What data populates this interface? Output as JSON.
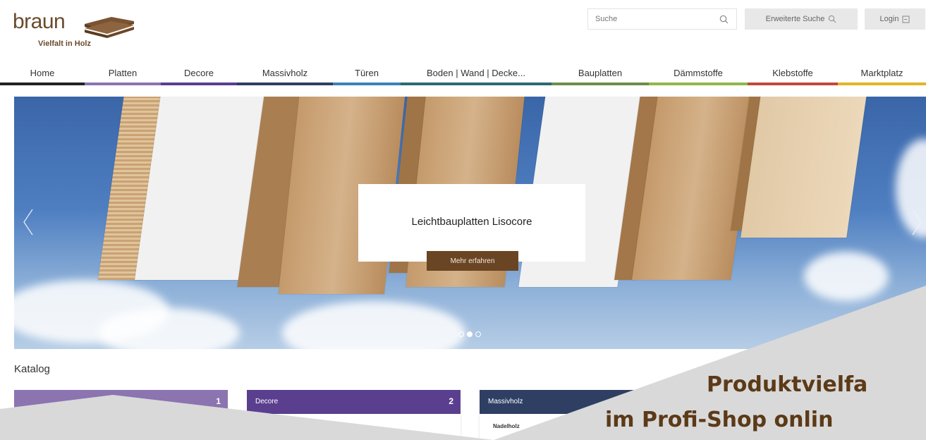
{
  "header": {
    "logo_word": "braun",
    "logo_tagline": "Vielfalt in Holz",
    "search_placeholder": "Suche",
    "advanced_search_label": "Erweiterte Suche",
    "login_label": "Login"
  },
  "nav": {
    "items": [
      {
        "label": "Home",
        "color": "#222222"
      },
      {
        "label": "Platten",
        "color": "#8b74b0"
      },
      {
        "label": "Decore",
        "color": "#5b3f8f"
      },
      {
        "label": "Massivholz",
        "color": "#2e3f63"
      },
      {
        "label": "Türen",
        "color": "#3b82bf"
      },
      {
        "label": "Boden | Wand | Decke...",
        "color": "#2c6b6f"
      },
      {
        "label": "Bauplatten",
        "color": "#6d8f4e"
      },
      {
        "label": "Dämmstoffe",
        "color": "#8fb84a"
      },
      {
        "label": "Klebstoffe",
        "color": "#c0493a"
      },
      {
        "label": "Marktplatz",
        "color": "#e3b428"
      }
    ]
  },
  "hero": {
    "title": "Leichtbauplatten Lisocore",
    "cta": "Mehr erfahren",
    "slides": 3,
    "active_slide": 2
  },
  "catalog": {
    "heading": "Katalog",
    "tiles": [
      {
        "title": "",
        "number": "1",
        "color": "#8b74b0"
      },
      {
        "title": "Decore",
        "number": "2",
        "color": "#5b3f8f"
      },
      {
        "title": "Massivholz",
        "number": "",
        "color": "#2e3f63"
      }
    ],
    "massivholz_item": "Nadelholz"
  },
  "promo": {
    "line1": "Produktvielfa",
    "line2": "im Profi-Shop onlin"
  },
  "colors": {
    "brand_brown": "#6a4524",
    "overlay_grey": "#d9d9d9"
  }
}
